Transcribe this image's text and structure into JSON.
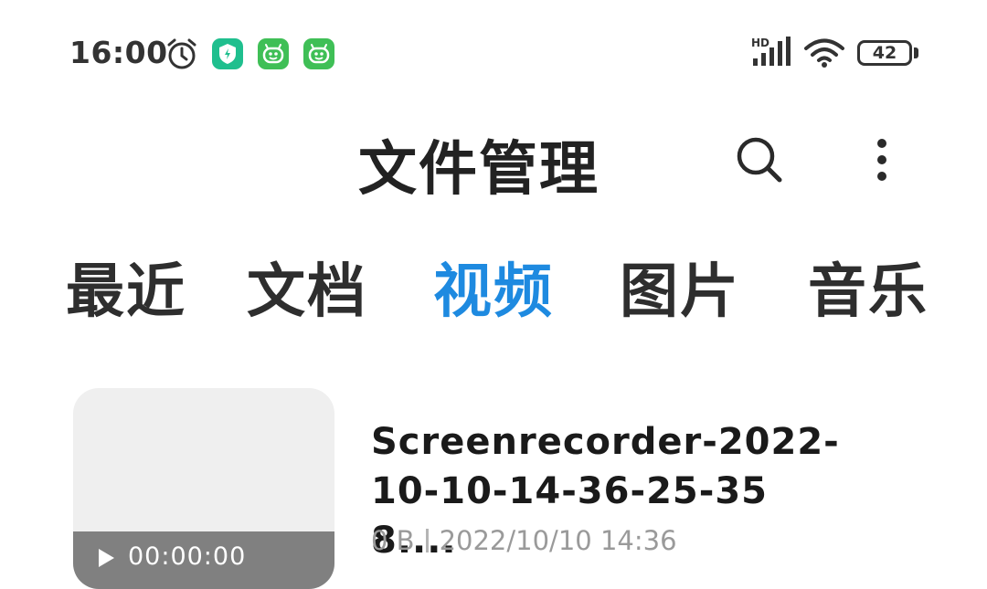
{
  "status_bar": {
    "time": "16:00",
    "network_type": "HD",
    "battery_level": "42",
    "icons": [
      "alarm-icon",
      "shield-app-icon",
      "robot-app-icon",
      "robot-app-icon",
      "signal-icon",
      "wifi-icon",
      "battery-icon"
    ]
  },
  "header": {
    "title": "文件管理",
    "search_icon": "search-icon",
    "more_icon": "more-vertical-icon"
  },
  "tabs": [
    {
      "label": "最近",
      "active": false
    },
    {
      "label": "文档",
      "active": false
    },
    {
      "label": "视频",
      "active": true
    },
    {
      "label": "图片",
      "active": false
    },
    {
      "label": "音乐",
      "active": false
    }
  ],
  "colors": {
    "accent": "#1e8ae0",
    "badge_shield": "#1fbf8e",
    "badge_bot": "#3fbf56"
  },
  "files": [
    {
      "name": "Screenrecorder-2022-10-10-14-36-25-358....",
      "duration": "00:00:00",
      "size": "0 B",
      "date": "2022/10/10 14:36"
    }
  ]
}
